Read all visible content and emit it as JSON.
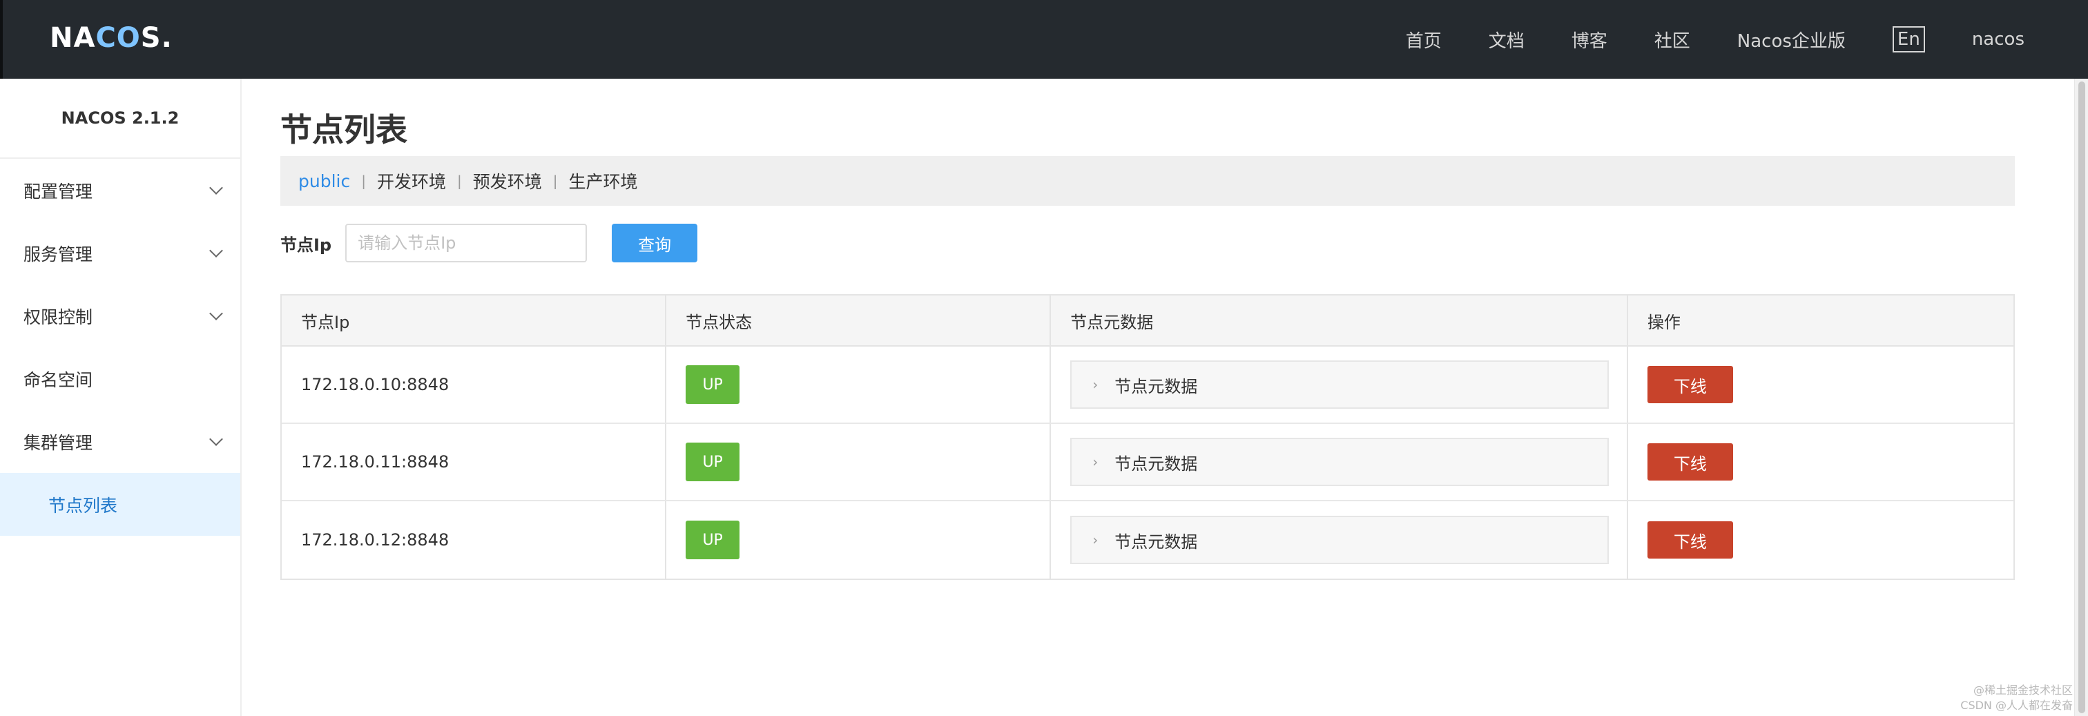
{
  "topbar": {
    "logo_pre": "NA",
    "logo_co": "CO",
    "logo_post": "S.",
    "nav": [
      "首页",
      "文档",
      "博客",
      "社区",
      "Nacos企业版"
    ],
    "lang": "En",
    "user": "nacos"
  },
  "sidebar": {
    "version": "NACOS 2.1.2",
    "items": [
      {
        "label": "配置管理",
        "expandable": true
      },
      {
        "label": "服务管理",
        "expandable": true
      },
      {
        "label": "权限控制",
        "expandable": true
      },
      {
        "label": "命名空间",
        "expandable": false
      },
      {
        "label": "集群管理",
        "expandable": true
      }
    ],
    "sub_item": "节点列表"
  },
  "main": {
    "title": "节点列表",
    "namespaces": [
      "public",
      "开发环境",
      "预发环境",
      "生产环境"
    ],
    "search": {
      "label": "节点Ip",
      "placeholder": "请输入节点Ip",
      "button": "查询"
    },
    "table": {
      "headers": [
        "节点Ip",
        "节点状态",
        "节点元数据",
        "操作"
      ],
      "rows": [
        {
          "ip": "172.18.0.10:8848",
          "status": "UP",
          "meta": "节点元数据",
          "action": "下线"
        },
        {
          "ip": "172.18.0.11:8848",
          "status": "UP",
          "meta": "节点元数据",
          "action": "下线"
        },
        {
          "ip": "172.18.0.12:8848",
          "status": "UP",
          "meta": "节点元数据",
          "action": "下线"
        }
      ]
    }
  },
  "watermark": {
    "line1": "@稀土掘金技术社区",
    "line2": "CSDN @人人都在发奋"
  },
  "colors": {
    "topbar": "#252a2f",
    "accent": "#3c9ef0",
    "status_up": "#63b83c",
    "danger": "#c8432b",
    "active_menu_bg": "#e5f3ff"
  }
}
